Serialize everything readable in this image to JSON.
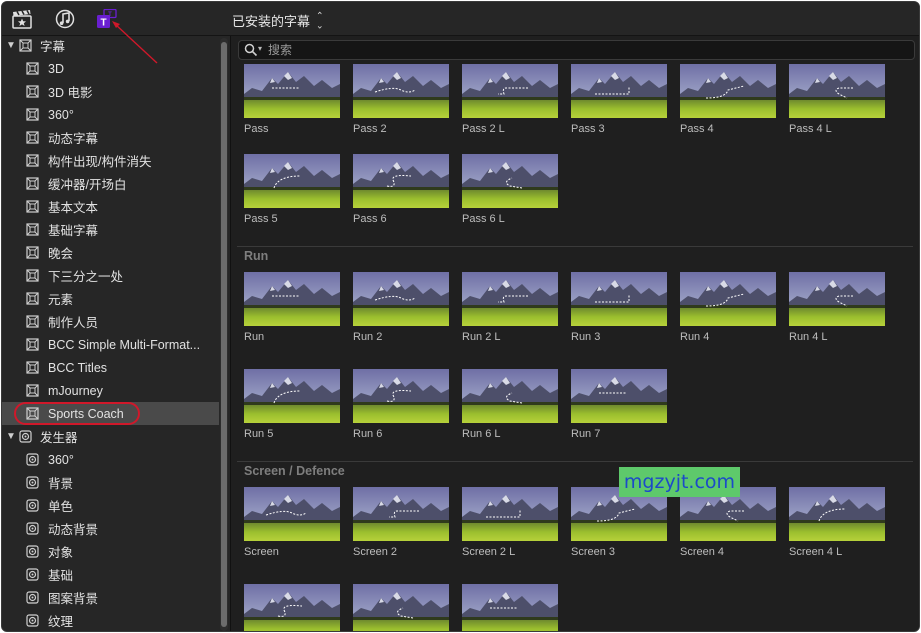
{
  "toolbar": {
    "icons": [
      "clapper-icon",
      "music-icon",
      "titles-icon"
    ],
    "browser_title": "已安装的字幕",
    "titles_badge_color": "#6a1fd1",
    "annotation_color": "#d0182a"
  },
  "sidebar": {
    "titles_group": {
      "label": "字幕",
      "items": [
        "3D",
        "3D 电影",
        "360°",
        "动态字幕",
        "构件出现/构件消失",
        "缓冲器/开场白",
        "基本文本",
        "基础字幕",
        "晚会",
        "下三分之一处",
        "元素",
        "制作人员",
        "BCC Simple Multi-Format...",
        "BCC Titles",
        "mJourney",
        "Sports Coach"
      ],
      "selected": "Sports Coach"
    },
    "generators_group": {
      "label": "发生器",
      "items": [
        "360°",
        "背景",
        "单色",
        "动态背景",
        "对象",
        "基础",
        "图案背景",
        "纹理"
      ]
    }
  },
  "search": {
    "placeholder": "搜索",
    "value": ""
  },
  "sections": [
    {
      "heading": "",
      "rows": [
        [
          "Pass",
          "Pass 2",
          "Pass 2 L",
          "Pass 3",
          "Pass 4",
          "Pass 4 L"
        ],
        [
          "Pass 5",
          "Pass 6",
          "Pass 6 L"
        ]
      ]
    },
    {
      "heading": "Run",
      "rows": [
        [
          "Run",
          "Run 2",
          "Run 2 L",
          "Run 3",
          "Run 4",
          "Run 4 L"
        ],
        [
          "Run 5",
          "Run 6",
          "Run 6 L",
          "Run 7"
        ]
      ]
    },
    {
      "heading": "Screen / Defence",
      "rows": [
        [
          "Screen",
          "Screen 2",
          "Screen 2 L",
          "Screen 3",
          "Screen 4",
          "Screen 4 L"
        ],
        [
          "",
          "",
          ""
        ]
      ]
    }
  ],
  "watermark": "mgzyjt.com"
}
